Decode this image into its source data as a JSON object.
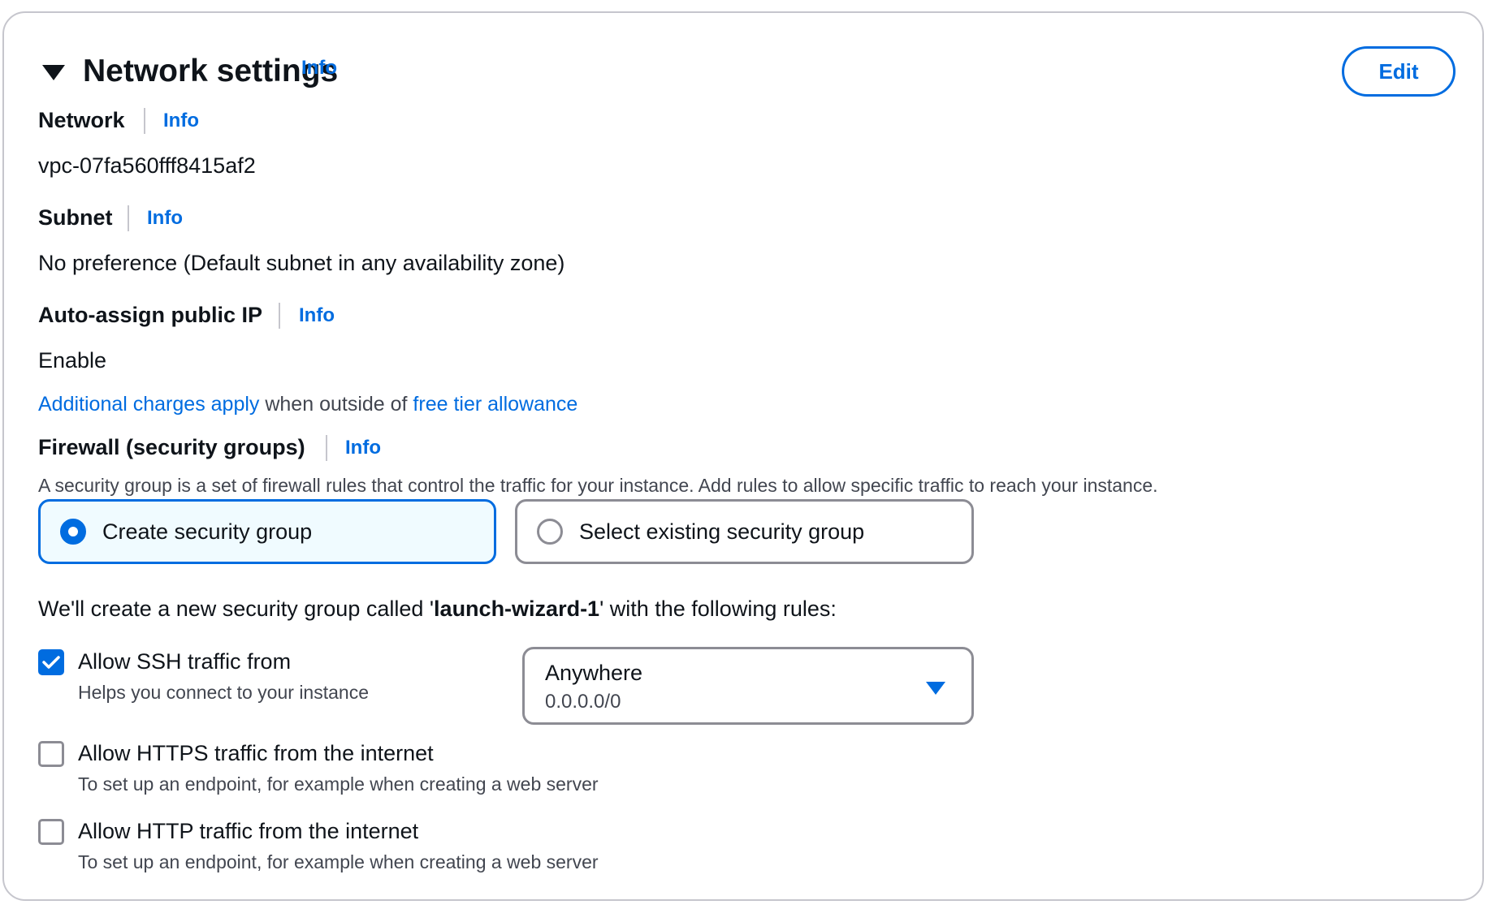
{
  "header": {
    "title": "Network settings",
    "info": "Info",
    "edit": "Edit"
  },
  "network": {
    "label": "Network",
    "info": "Info",
    "value": "vpc-07fa560fff8415af2"
  },
  "subnet": {
    "label": "Subnet",
    "info": "Info",
    "value": "No preference (Default subnet in any availability zone)"
  },
  "public_ip": {
    "label": "Auto-assign public IP",
    "info": "Info",
    "value": "Enable",
    "note_link1": "Additional charges apply",
    "note_middle": " when outside of ",
    "note_link2": "free tier allowance"
  },
  "firewall": {
    "label": "Firewall (security groups)",
    "info": "Info",
    "description": "A security group is a set of firewall rules that control the traffic for your instance. Add rules to allow specific traffic to reach your instance.",
    "options": [
      {
        "label": "Create security group",
        "selected": true
      },
      {
        "label": "Select existing security group",
        "selected": false
      }
    ],
    "summary_prefix": "We'll create a new security group called '",
    "summary_name": "launch-wizard-1",
    "summary_suffix": "' with the following rules:"
  },
  "rules": {
    "ssh": {
      "label": "Allow SSH traffic from",
      "description": "Helps you connect to your instance",
      "checked": true,
      "source": "Anywhere",
      "source_cidr": "0.0.0.0/0"
    },
    "https": {
      "label": "Allow HTTPS traffic from the internet",
      "description": "To set up an endpoint, for example when creating a web server",
      "checked": false
    },
    "http": {
      "label": "Allow HTTP traffic from the internet",
      "description": "To set up an endpoint, for example when creating a web server",
      "checked": false
    }
  },
  "colors": {
    "accent": "#006ce0",
    "border": "#c6c6cd",
    "text": "#0f141a",
    "secondary_text": "#424650",
    "selected_tile_bg": "#f0fbff"
  },
  "icons": {
    "expand": "caret-down-icon",
    "dropdown": "caret-down-icon",
    "checkbox_checked": "checkmark-icon"
  }
}
